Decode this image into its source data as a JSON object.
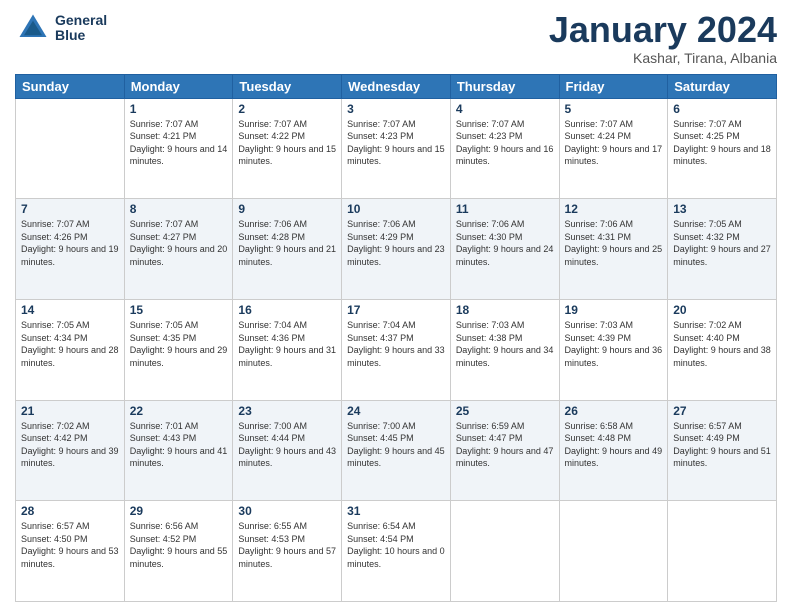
{
  "header": {
    "logo_line1": "General",
    "logo_line2": "Blue",
    "month": "January 2024",
    "location": "Kashar, Tirana, Albania"
  },
  "weekdays": [
    "Sunday",
    "Monday",
    "Tuesday",
    "Wednesday",
    "Thursday",
    "Friday",
    "Saturday"
  ],
  "weeks": [
    [
      {
        "day": "",
        "sunrise": "",
        "sunset": "",
        "daylight": ""
      },
      {
        "day": "1",
        "sunrise": "Sunrise: 7:07 AM",
        "sunset": "Sunset: 4:21 PM",
        "daylight": "Daylight: 9 hours and 14 minutes."
      },
      {
        "day": "2",
        "sunrise": "Sunrise: 7:07 AM",
        "sunset": "Sunset: 4:22 PM",
        "daylight": "Daylight: 9 hours and 15 minutes."
      },
      {
        "day": "3",
        "sunrise": "Sunrise: 7:07 AM",
        "sunset": "Sunset: 4:23 PM",
        "daylight": "Daylight: 9 hours and 15 minutes."
      },
      {
        "day": "4",
        "sunrise": "Sunrise: 7:07 AM",
        "sunset": "Sunset: 4:23 PM",
        "daylight": "Daylight: 9 hours and 16 minutes."
      },
      {
        "day": "5",
        "sunrise": "Sunrise: 7:07 AM",
        "sunset": "Sunset: 4:24 PM",
        "daylight": "Daylight: 9 hours and 17 minutes."
      },
      {
        "day": "6",
        "sunrise": "Sunrise: 7:07 AM",
        "sunset": "Sunset: 4:25 PM",
        "daylight": "Daylight: 9 hours and 18 minutes."
      }
    ],
    [
      {
        "day": "7",
        "sunrise": "Sunrise: 7:07 AM",
        "sunset": "Sunset: 4:26 PM",
        "daylight": "Daylight: 9 hours and 19 minutes."
      },
      {
        "day": "8",
        "sunrise": "Sunrise: 7:07 AM",
        "sunset": "Sunset: 4:27 PM",
        "daylight": "Daylight: 9 hours and 20 minutes."
      },
      {
        "day": "9",
        "sunrise": "Sunrise: 7:06 AM",
        "sunset": "Sunset: 4:28 PM",
        "daylight": "Daylight: 9 hours and 21 minutes."
      },
      {
        "day": "10",
        "sunrise": "Sunrise: 7:06 AM",
        "sunset": "Sunset: 4:29 PM",
        "daylight": "Daylight: 9 hours and 23 minutes."
      },
      {
        "day": "11",
        "sunrise": "Sunrise: 7:06 AM",
        "sunset": "Sunset: 4:30 PM",
        "daylight": "Daylight: 9 hours and 24 minutes."
      },
      {
        "day": "12",
        "sunrise": "Sunrise: 7:06 AM",
        "sunset": "Sunset: 4:31 PM",
        "daylight": "Daylight: 9 hours and 25 minutes."
      },
      {
        "day": "13",
        "sunrise": "Sunrise: 7:05 AM",
        "sunset": "Sunset: 4:32 PM",
        "daylight": "Daylight: 9 hours and 27 minutes."
      }
    ],
    [
      {
        "day": "14",
        "sunrise": "Sunrise: 7:05 AM",
        "sunset": "Sunset: 4:34 PM",
        "daylight": "Daylight: 9 hours and 28 minutes."
      },
      {
        "day": "15",
        "sunrise": "Sunrise: 7:05 AM",
        "sunset": "Sunset: 4:35 PM",
        "daylight": "Daylight: 9 hours and 29 minutes."
      },
      {
        "day": "16",
        "sunrise": "Sunrise: 7:04 AM",
        "sunset": "Sunset: 4:36 PM",
        "daylight": "Daylight: 9 hours and 31 minutes."
      },
      {
        "day": "17",
        "sunrise": "Sunrise: 7:04 AM",
        "sunset": "Sunset: 4:37 PM",
        "daylight": "Daylight: 9 hours and 33 minutes."
      },
      {
        "day": "18",
        "sunrise": "Sunrise: 7:03 AM",
        "sunset": "Sunset: 4:38 PM",
        "daylight": "Daylight: 9 hours and 34 minutes."
      },
      {
        "day": "19",
        "sunrise": "Sunrise: 7:03 AM",
        "sunset": "Sunset: 4:39 PM",
        "daylight": "Daylight: 9 hours and 36 minutes."
      },
      {
        "day": "20",
        "sunrise": "Sunrise: 7:02 AM",
        "sunset": "Sunset: 4:40 PM",
        "daylight": "Daylight: 9 hours and 38 minutes."
      }
    ],
    [
      {
        "day": "21",
        "sunrise": "Sunrise: 7:02 AM",
        "sunset": "Sunset: 4:42 PM",
        "daylight": "Daylight: 9 hours and 39 minutes."
      },
      {
        "day": "22",
        "sunrise": "Sunrise: 7:01 AM",
        "sunset": "Sunset: 4:43 PM",
        "daylight": "Daylight: 9 hours and 41 minutes."
      },
      {
        "day": "23",
        "sunrise": "Sunrise: 7:00 AM",
        "sunset": "Sunset: 4:44 PM",
        "daylight": "Daylight: 9 hours and 43 minutes."
      },
      {
        "day": "24",
        "sunrise": "Sunrise: 7:00 AM",
        "sunset": "Sunset: 4:45 PM",
        "daylight": "Daylight: 9 hours and 45 minutes."
      },
      {
        "day": "25",
        "sunrise": "Sunrise: 6:59 AM",
        "sunset": "Sunset: 4:47 PM",
        "daylight": "Daylight: 9 hours and 47 minutes."
      },
      {
        "day": "26",
        "sunrise": "Sunrise: 6:58 AM",
        "sunset": "Sunset: 4:48 PM",
        "daylight": "Daylight: 9 hours and 49 minutes."
      },
      {
        "day": "27",
        "sunrise": "Sunrise: 6:57 AM",
        "sunset": "Sunset: 4:49 PM",
        "daylight": "Daylight: 9 hours and 51 minutes."
      }
    ],
    [
      {
        "day": "28",
        "sunrise": "Sunrise: 6:57 AM",
        "sunset": "Sunset: 4:50 PM",
        "daylight": "Daylight: 9 hours and 53 minutes."
      },
      {
        "day": "29",
        "sunrise": "Sunrise: 6:56 AM",
        "sunset": "Sunset: 4:52 PM",
        "daylight": "Daylight: 9 hours and 55 minutes."
      },
      {
        "day": "30",
        "sunrise": "Sunrise: 6:55 AM",
        "sunset": "Sunset: 4:53 PM",
        "daylight": "Daylight: 9 hours and 57 minutes."
      },
      {
        "day": "31",
        "sunrise": "Sunrise: 6:54 AM",
        "sunset": "Sunset: 4:54 PM",
        "daylight": "Daylight: 10 hours and 0 minutes."
      },
      {
        "day": "",
        "sunrise": "",
        "sunset": "",
        "daylight": ""
      },
      {
        "day": "",
        "sunrise": "",
        "sunset": "",
        "daylight": ""
      },
      {
        "day": "",
        "sunrise": "",
        "sunset": "",
        "daylight": ""
      }
    ]
  ]
}
